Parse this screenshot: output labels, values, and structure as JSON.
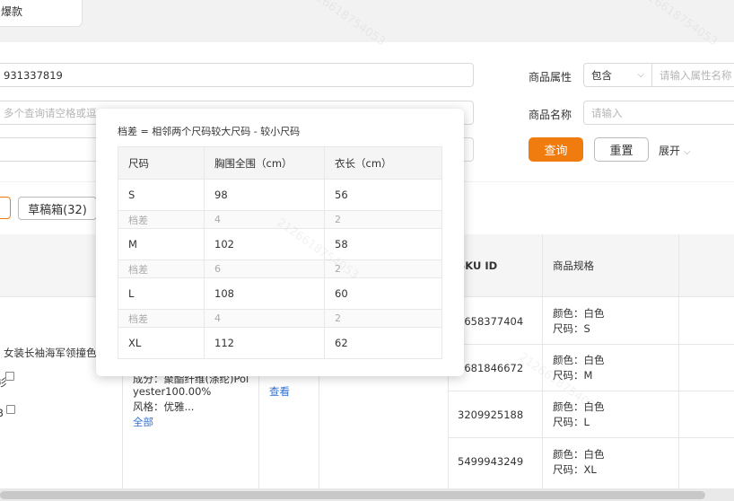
{
  "top_tab": {
    "label": "爆款"
  },
  "search": {
    "id_value": "931337819",
    "multi_query_placeholder": "多个查询请空格或逗",
    "attr_label": "商品属性",
    "attr_select": "包含",
    "attr_placeholder": "请输入属性名称",
    "name_label": "商品名称",
    "name_placeholder": "请输入",
    "query_btn": "查询",
    "reset_btn": "重置",
    "expand_btn": "展开"
  },
  "tabs": {
    "draft": "草稿箱(32)"
  },
  "table": {
    "sku_header": "SKU ID",
    "spec_header": "商品规格",
    "product_title": "女装长袖海军领撞色",
    "product_partial_1": "衫",
    "product_partial_2": "B",
    "attr_partial": "成分：聚酯纤维(涤纶)Pol",
    "attr_line2": "yester100.00%",
    "attr_line3": "风格：优雅...",
    "attr_all": "全部",
    "view_link": "查看",
    "rows": [
      {
        "sku": "3658377404",
        "color": "颜色：白色",
        "size": "尺码：S"
      },
      {
        "sku": "3681846672",
        "color": "颜色：白色",
        "size": "尺码：M"
      },
      {
        "sku": "3209925188",
        "color": "颜色：白色",
        "size": "尺码：L"
      },
      {
        "sku": "5499943249",
        "color": "颜色：白色",
        "size": "尺码：XL"
      }
    ]
  },
  "popup": {
    "title": "档差 = 相邻两个尺码较大尺码 - 较小尺码",
    "headers": [
      "尺码",
      "胸围全围（cm）",
      "衣长（cm）"
    ],
    "rows": [
      {
        "size": "S",
        "chest": "98",
        "length": "56"
      },
      {
        "diff_label": "档差",
        "chest": "4",
        "length": "2"
      },
      {
        "size": "M",
        "chest": "102",
        "length": "58"
      },
      {
        "diff_label": "档差",
        "chest": "6",
        "length": "2"
      },
      {
        "size": "L",
        "chest": "108",
        "length": "60"
      },
      {
        "diff_label": "档差",
        "chest": "4",
        "length": "2"
      },
      {
        "size": "XL",
        "chest": "112",
        "length": "62"
      }
    ]
  },
  "watermark": "2126618754053",
  "colors": {
    "accent": "#f07c10",
    "link": "#2f6fd6"
  }
}
